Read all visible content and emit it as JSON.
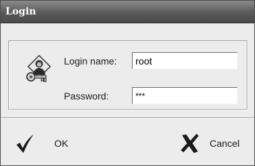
{
  "window": {
    "title": "Login"
  },
  "form": {
    "login_label": "Login name:",
    "login_value": "root",
    "password_label": "Password:",
    "password_value": "***"
  },
  "buttons": {
    "ok_label": "OK",
    "cancel_label": "Cancel"
  },
  "icons": {
    "login": "user-key-icon",
    "ok": "checkmark-icon",
    "cancel": "x-icon"
  }
}
